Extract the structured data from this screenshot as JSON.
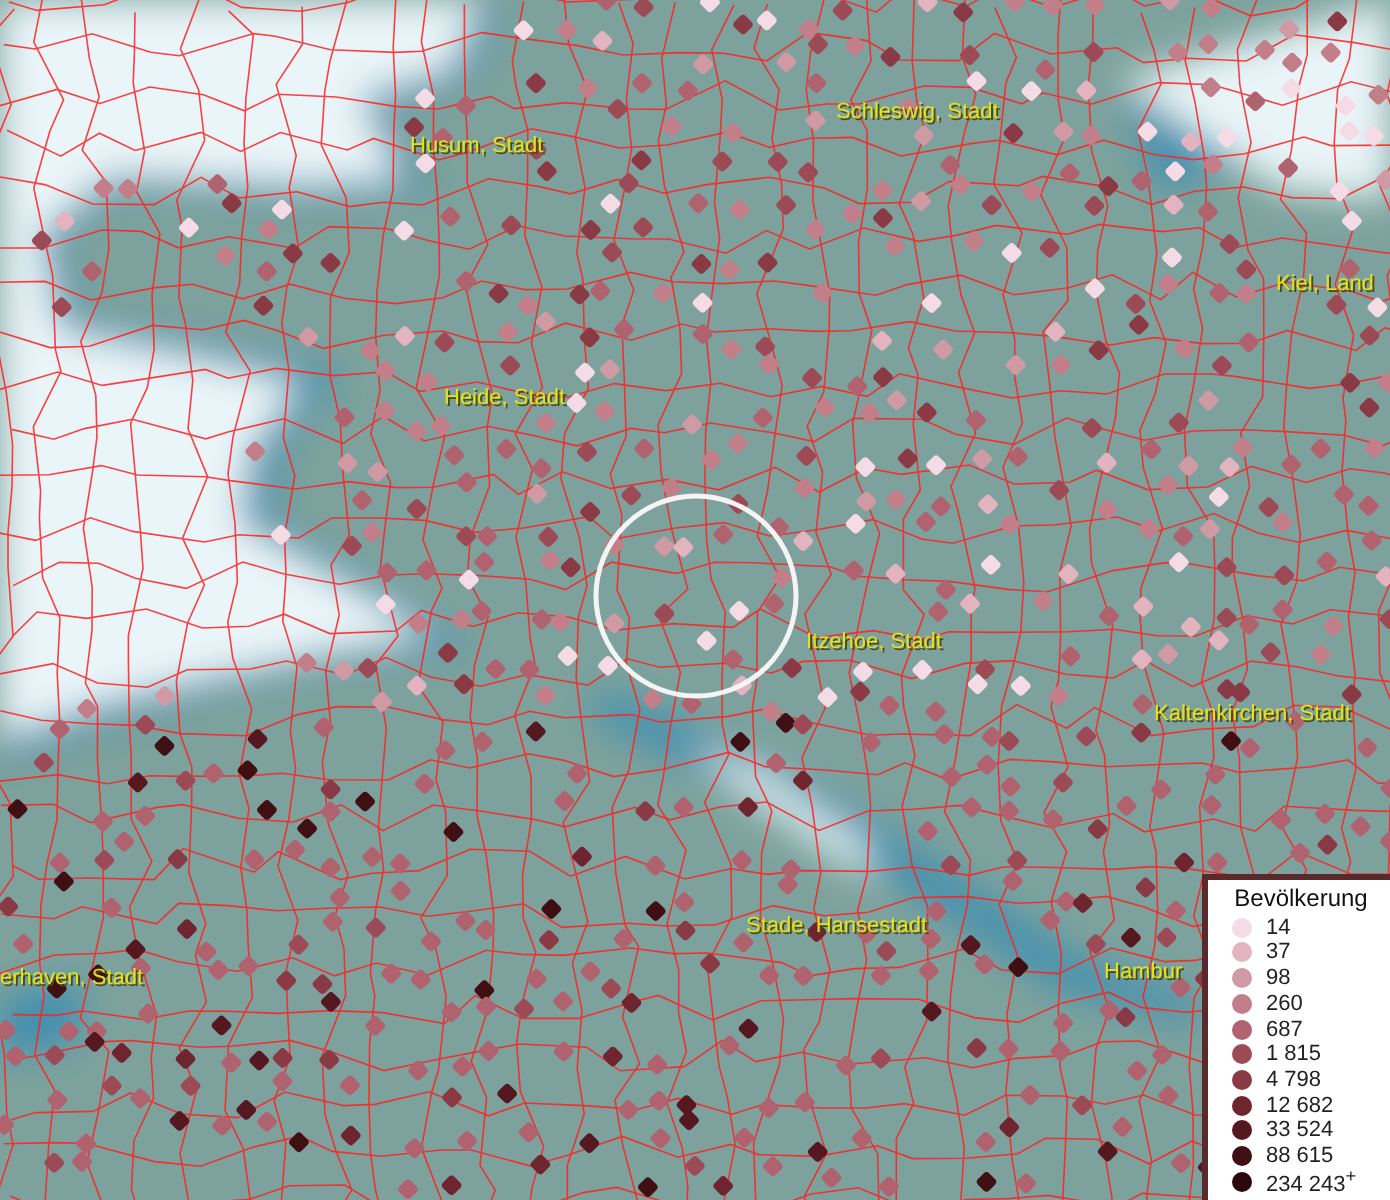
{
  "map": {
    "place_labels": [
      {
        "text": "Schleswig, Stadt"
      },
      {
        "text": "Husum, Stadt"
      },
      {
        "text": "Kiel, Land"
      },
      {
        "text": "Heide, Stadt"
      },
      {
        "text": "Itzehoe, Stadt"
      },
      {
        "text": "Kaltenkirchen, Stadt"
      },
      {
        "text": "Stade, Hansestadt"
      },
      {
        "text": "erhaven, Stadt"
      },
      {
        "text": "Hambur"
      }
    ]
  },
  "legend": {
    "title": "Bevölkerung",
    "items": [
      {
        "label": "14",
        "color": "#f5dbe6"
      },
      {
        "label": "37",
        "color": "#e3b3c0"
      },
      {
        "label": "98",
        "color": "#d09aa4"
      },
      {
        "label": "260",
        "color": "#c27f89"
      },
      {
        "label": "687",
        "color": "#b0636e"
      },
      {
        "label": "1 815",
        "color": "#9c4a55"
      },
      {
        "label": "4 798",
        "color": "#8a3a44"
      },
      {
        "label": "12 682",
        "color": "#6e2530"
      },
      {
        "label": "33 524",
        "color": "#551820"
      },
      {
        "label": "88 615",
        "color": "#3f0f14"
      },
      {
        "label": "234 243$^{+}$",
        "color": "#2a070b"
      }
    ]
  }
}
